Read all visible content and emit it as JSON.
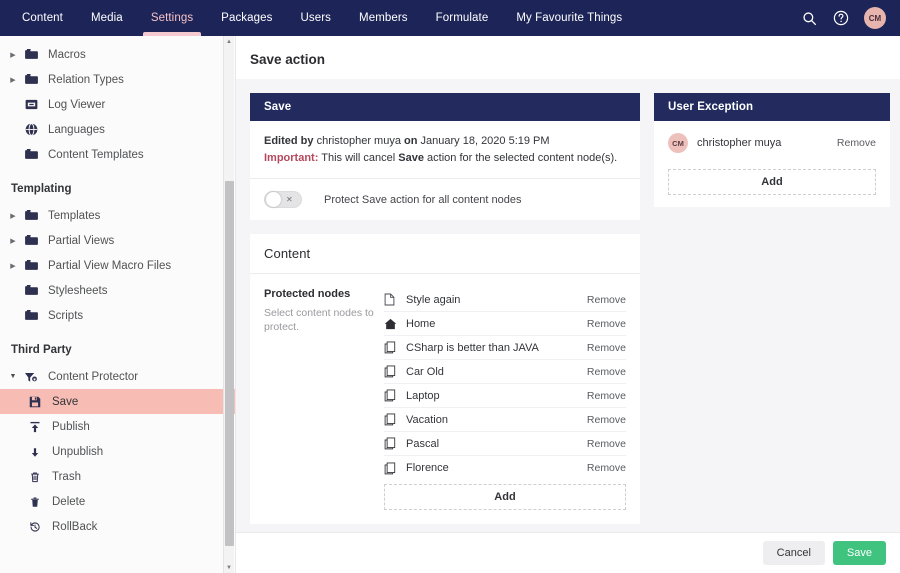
{
  "topnav": {
    "items": [
      {
        "label": "Content",
        "active": false
      },
      {
        "label": "Media",
        "active": false
      },
      {
        "label": "Settings",
        "active": true
      },
      {
        "label": "Packages",
        "active": false
      },
      {
        "label": "Users",
        "active": false
      },
      {
        "label": "Members",
        "active": false
      },
      {
        "label": "Formulate",
        "active": false
      },
      {
        "label": "My Favourite Things",
        "active": false
      }
    ],
    "search_icon": "search-icon",
    "help_icon": "help-icon",
    "avatar_initials": "CM",
    "background": "#1d2558",
    "active_underline": "#f5c9d0"
  },
  "sidebar": {
    "items": [
      {
        "label": "Macros",
        "icon": "folder-icon",
        "caret": "collapsed"
      },
      {
        "label": "Relation Types",
        "icon": "folder-icon",
        "caret": "collapsed"
      },
      {
        "label": "Log Viewer",
        "icon": "log-icon",
        "caret": "none"
      },
      {
        "label": "Languages",
        "icon": "globe-icon",
        "caret": "none"
      },
      {
        "label": "Content Templates",
        "icon": "folder-icon",
        "caret": "none"
      }
    ],
    "group_templating": "Templating",
    "templating_items": [
      {
        "label": "Templates",
        "icon": "folder-icon",
        "caret": "collapsed"
      },
      {
        "label": "Partial Views",
        "icon": "folder-icon",
        "caret": "collapsed"
      },
      {
        "label": "Partial View Macro Files",
        "icon": "folder-icon",
        "caret": "collapsed"
      },
      {
        "label": "Stylesheets",
        "icon": "folder-icon",
        "caret": "none"
      },
      {
        "label": "Scripts",
        "icon": "folder-icon",
        "caret": "none"
      }
    ],
    "group_third_party": "Third Party",
    "third_party_items": [
      {
        "label": "Content Protector",
        "icon": "plugin-icon",
        "caret": "open"
      }
    ],
    "protector_children": [
      {
        "label": "Save",
        "icon": "save-icon",
        "selected": true
      },
      {
        "label": "Publish",
        "icon": "publish-icon",
        "selected": false
      },
      {
        "label": "Unpublish",
        "icon": "unpublish-icon",
        "selected": false
      },
      {
        "label": "Trash",
        "icon": "trash-icon",
        "selected": false
      },
      {
        "label": "Delete",
        "icon": "delete-icon",
        "selected": false
      },
      {
        "label": "RollBack",
        "icon": "rollback-icon",
        "selected": false
      }
    ],
    "selected_highlight": "#f7bdb4"
  },
  "main": {
    "page_title": "Save action",
    "save_card": {
      "header": "Save",
      "edited_prefix": "Edited by",
      "edited_user": "christopher muya",
      "edited_on": "on",
      "edited_date": "January 18, 2020 5:19 PM",
      "important_label": "Important:",
      "important_text_1": "This will cancel",
      "important_bold": "Save",
      "important_text_2": "action for the selected content node(s).",
      "toggle_state": "off",
      "toggle_mark": "✕",
      "toggle_label": "Protect Save action for all content nodes"
    },
    "content_card": {
      "header": "Content",
      "side_title": "Protected nodes",
      "side_desc": "Select content nodes to protect.",
      "remove_label": "Remove",
      "add_label": "Add",
      "nodes": [
        {
          "name": "Style again",
          "icon": "document-icon"
        },
        {
          "name": "Home",
          "icon": "home-icon"
        },
        {
          "name": "CSharp is better than JAVA",
          "icon": "copy-icon"
        },
        {
          "name": "Car Old",
          "icon": "copy-icon"
        },
        {
          "name": "Laptop",
          "icon": "copy-icon"
        },
        {
          "name": "Vacation",
          "icon": "copy-icon"
        },
        {
          "name": "Pascal",
          "icon": "copy-icon"
        },
        {
          "name": "Florence",
          "icon": "copy-icon"
        }
      ]
    },
    "user_exception_card": {
      "header": "User Exception",
      "remove_label": "Remove",
      "add_label": "Add",
      "users": [
        {
          "name": "christopher muya",
          "initials": "CM"
        }
      ]
    }
  },
  "footer": {
    "cancel_label": "Cancel",
    "save_label": "Save",
    "save_color": "#3fc37f"
  }
}
